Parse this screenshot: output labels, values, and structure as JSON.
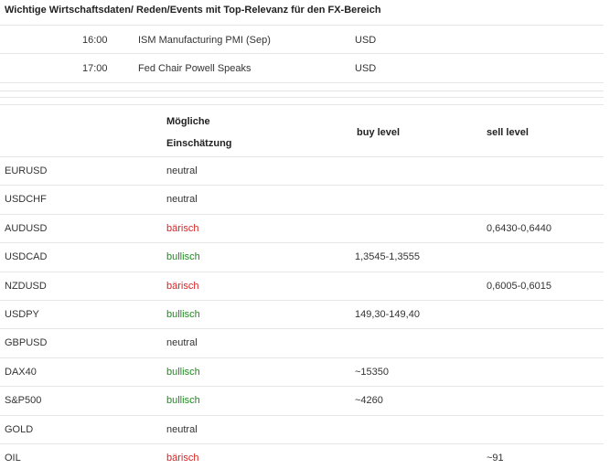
{
  "title": "Wichtige Wirtschaftsdaten/ Reden/Events mit Top-Relevanz für den FX-Bereich",
  "events": [
    {
      "time": "16:00",
      "event": "ISM Manufacturing PMI (Sep)",
      "currency": "USD"
    },
    {
      "time": "17:00",
      "event": "Fed Chair Powell Speaks",
      "currency": "USD"
    }
  ],
  "headers": {
    "assessment_line1": "Mögliche",
    "assessment_line2": "Einschätzung",
    "buy": "buy level",
    "sell": "sell level"
  },
  "rows": [
    {
      "pair": "EURUSD",
      "assessment": "neutral",
      "buy": "",
      "sell": ""
    },
    {
      "pair": "USDCHF",
      "assessment": "neutral",
      "buy": "",
      "sell": ""
    },
    {
      "pair": "AUDUSD",
      "assessment": "bärisch",
      "buy": "",
      "sell": "0,6430-0,6440"
    },
    {
      "pair": "USDCAD",
      "assessment": "bullisch",
      "buy": "1,3545-1,3555",
      "sell": ""
    },
    {
      "pair": "NZDUSD",
      "assessment": "bärisch",
      "buy": "",
      "sell": "0,6005-0,6015"
    },
    {
      "pair": "USDPY",
      "assessment": "bullisch",
      "buy": "149,30-149,40",
      "sell": ""
    },
    {
      "pair": "GBPUSD",
      "assessment": "neutral",
      "buy": "",
      "sell": ""
    },
    {
      "pair": "DAX40",
      "assessment": "bullisch",
      "buy": "~15350",
      "sell": ""
    },
    {
      "pair": "S&P500",
      "assessment": "bullisch",
      "buy": "~4260",
      "sell": ""
    },
    {
      "pair": "GOLD",
      "assessment": "neutral",
      "buy": "",
      "sell": ""
    },
    {
      "pair": "OIL",
      "assessment": "bärisch",
      "buy": "",
      "sell": "~91"
    }
  ],
  "colors": {
    "bullisch": "#1e8c1e",
    "bärisch": "#d42424",
    "neutral": "#333333"
  }
}
